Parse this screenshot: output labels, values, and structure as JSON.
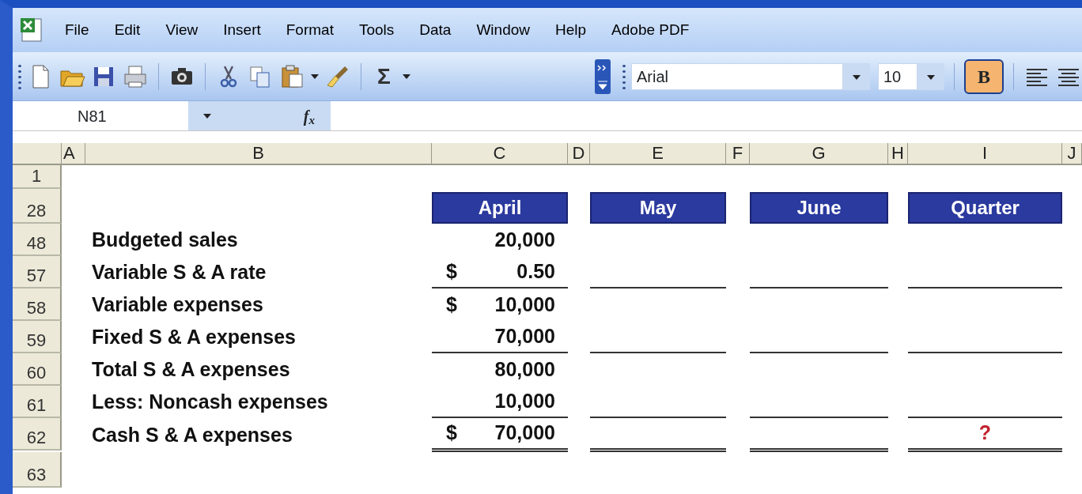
{
  "menu": [
    "File",
    "Edit",
    "View",
    "Insert",
    "Format",
    "Tools",
    "Data",
    "Window",
    "Help",
    "Adobe PDF"
  ],
  "toolbar": {
    "autosum": "Σ",
    "font": "Arial",
    "size": "10",
    "bold_label": "B",
    "bold_pressed": true
  },
  "formula_bar": {
    "name_box": "N81",
    "fx": "f$_{x}$"
  },
  "columns": [
    "A",
    "B",
    "C",
    "D",
    "E",
    "F",
    "G",
    "H",
    "I",
    "J"
  ],
  "period_headers": [
    "April",
    "May",
    "June",
    "Quarter"
  ],
  "rows": [
    {
      "number": "1",
      "kind": "blank"
    },
    {
      "number": "28",
      "kind": "headers"
    },
    {
      "number": "48",
      "kind": "line",
      "label": "Budgeted sales",
      "currency": "",
      "april": "20,000",
      "quarter": "",
      "single_rule": false,
      "double_rule": false
    },
    {
      "number": "57",
      "kind": "line",
      "label": "Variable S & A rate",
      "currency": "$",
      "april": "0.50",
      "quarter": "",
      "single_rule": true,
      "double_rule": false
    },
    {
      "number": "58",
      "kind": "line",
      "label": "Variable expenses",
      "currency": "$",
      "april": "10,000",
      "quarter": "",
      "single_rule": false,
      "double_rule": false
    },
    {
      "number": "59",
      "kind": "line",
      "label": "Fixed S & A expenses",
      "currency": "",
      "april": "70,000",
      "quarter": "",
      "single_rule": true,
      "double_rule": false
    },
    {
      "number": "60",
      "kind": "line",
      "label": "Total S & A expenses",
      "currency": "",
      "april": "80,000",
      "quarter": "",
      "single_rule": false,
      "double_rule": false
    },
    {
      "number": "61",
      "kind": "line",
      "label": "Less: Noncash expenses",
      "currency": "",
      "april": "10,000",
      "quarter": "",
      "single_rule": true,
      "double_rule": false
    },
    {
      "number": "62",
      "kind": "line",
      "label": "Cash S & A expenses",
      "currency": "$",
      "april": "70,000",
      "quarter": "?",
      "single_rule": false,
      "double_rule": true
    },
    {
      "number": "63",
      "kind": "blank"
    }
  ]
}
